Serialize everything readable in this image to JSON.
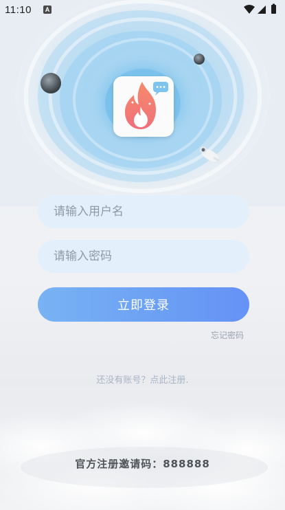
{
  "status_bar": {
    "time": "11:10",
    "notification_icon": "a-icon",
    "icons": [
      "wifi-icon",
      "signal-icon",
      "battery-icon"
    ]
  },
  "app": {
    "logo_icon": "flame-chat-icon"
  },
  "login": {
    "username_placeholder": "请输入用户名",
    "password_placeholder": "请输入密码",
    "login_button": "立即登录",
    "forgot_password": "忘记密码",
    "register_link": "还没有账号？点此注册.",
    "invite_code_text": "官方注册邀请码：888888"
  },
  "colors": {
    "accent": "#6b9ff4",
    "input_bg": "#e3f0fc"
  }
}
